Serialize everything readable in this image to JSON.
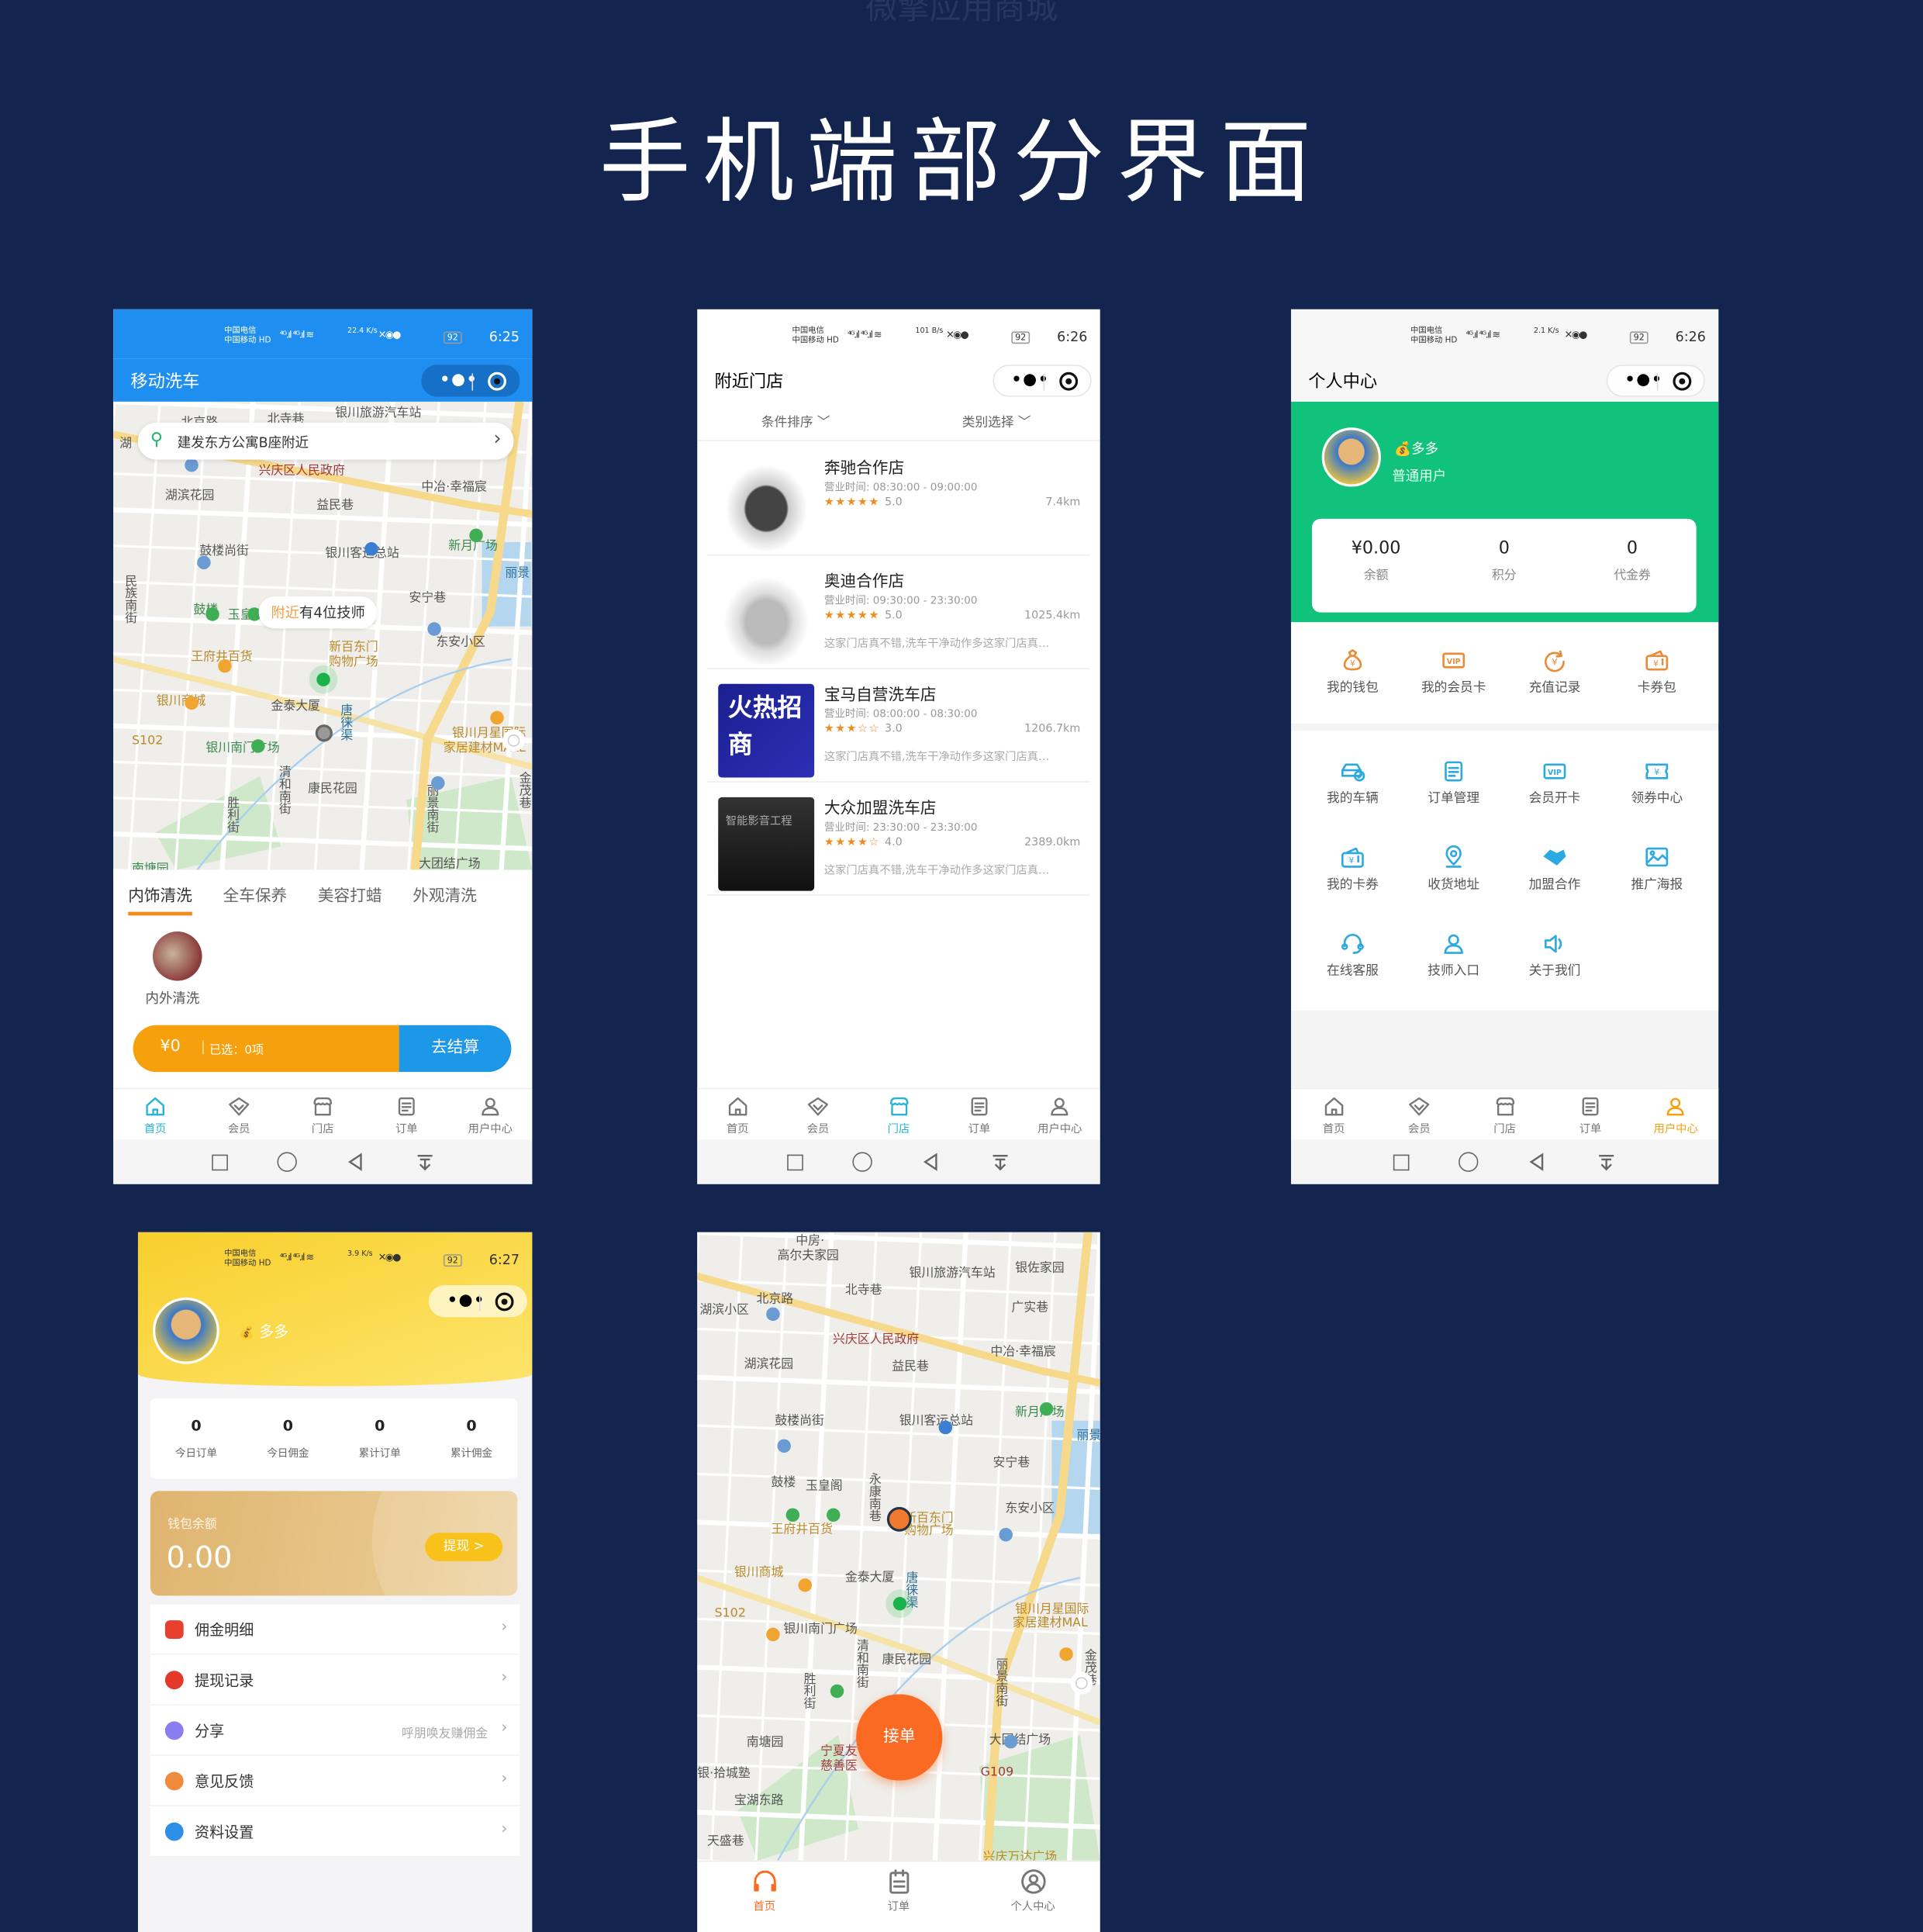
{
  "watermark": "微擎应用商城",
  "title": "手机端部分界面",
  "colors": {
    "background": "#13254f",
    "blue": "#1e8ff0",
    "green": "#10c27b",
    "orange": "#f5a00c",
    "teal": "#26b5d6",
    "fab": "#fb6a22",
    "yellow": "#fcd53a"
  },
  "status": {
    "carrier1": "中国电信",
    "carrier2": "中国移动 HD",
    "signal": "⁴ᴳ.ıl ⁴ᴳ.ıl ≋",
    "battery": "92"
  },
  "phone1": {
    "speed": "22.4 K/s",
    "time": "6:25",
    "title": "移动洗车",
    "location": "建发东方公寓B座附近",
    "nearby_prefix": "附近",
    "nearby_rest": "有4位技师",
    "tabs": [
      {
        "label": "内饰清洗",
        "active": true
      },
      {
        "label": "全车保养"
      },
      {
        "label": "美容打蜡"
      },
      {
        "label": "外观清洗"
      }
    ],
    "service": "内外清洗",
    "cart": {
      "price": "¥0",
      "selected": "已选：0项",
      "checkout": "去结算"
    },
    "map_labels": [
      "银川旅游汽车站",
      "北京路",
      "北寺巷",
      "湖",
      "兴庆区人民政府",
      "湖滨花园",
      "益民巷",
      "中冶·幸福宸",
      "鼓楼尚街",
      "银川客运总站",
      "新月广场",
      "安宁巷",
      "鼓楼",
      "玉皇",
      "东安小区",
      "王府井百货",
      "新百东门",
      "购物广场",
      "银川商城",
      "金泰大厦",
      "唐徕渠",
      "S102",
      "银川南门广场",
      "银川月星国际",
      "家居建材MALL",
      "康民花园",
      "清和南街",
      "胜利街",
      "丽景南街",
      "金茂巷",
      "大团结广场",
      "南塘园",
      "民族南街",
      "丽景"
    ]
  },
  "phone2": {
    "speed": "101 B/s",
    "time": "6:26",
    "title": "附近门店",
    "filters": [
      "条件排序",
      "类别选择"
    ],
    "stores": [
      {
        "name": "奔驰合作店",
        "hours": "营业时间:  08:30:00 - 09:00:00",
        "rating": "5.0",
        "distance": "7.4km",
        "review": ""
      },
      {
        "name": "奥迪合作店",
        "hours": "营业时间:  09:30:00 - 23:30:00",
        "rating": "5.0",
        "distance": "1025.4km",
        "review": "这家门店真不错,洗车干净动作多这家门店真…"
      },
      {
        "name": "宝马自营洗车店",
        "hours": "营业时间:  08:00:00 - 08:30:00",
        "rating": "3.0",
        "distance": "1206.7km",
        "review": "这家门店真不错,洗车干净动作多这家门店真…",
        "image_text": "火热招商"
      },
      {
        "name": "大众加盟洗车店",
        "hours": "营业时间:  23:30:00 - 23:30:00",
        "rating": "4.0",
        "distance": "2389.0km",
        "review": "这家门店真不错,洗车干净动作多这家门店真…",
        "image_text": "智能影音工程"
      }
    ]
  },
  "phone3": {
    "speed": "2.1 K/s",
    "time": "6:26",
    "title": "个人中心",
    "user": {
      "name": "多多",
      "level": "普通用户"
    },
    "stats": [
      {
        "value": "¥0.00",
        "label": "余额"
      },
      {
        "value": "0",
        "label": "积分"
      },
      {
        "value": "0",
        "label": "代金券"
      }
    ],
    "grid1": [
      {
        "label": "我的钱包",
        "icon": "money-bag"
      },
      {
        "label": "我的会员卡",
        "icon": "vip-card"
      },
      {
        "label": "充值记录",
        "icon": "recharge"
      },
      {
        "label": "卡券包",
        "icon": "coupon-wallet"
      }
    ],
    "grid2": [
      {
        "label": "我的车辆",
        "icon": "car"
      },
      {
        "label": "订单管理",
        "icon": "order"
      },
      {
        "label": "会员开卡",
        "icon": "vip-card"
      },
      {
        "label": "领券中心",
        "icon": "ticket"
      },
      {
        "label": "我的卡券",
        "icon": "coupon-wallet"
      },
      {
        "label": "收货地址",
        "icon": "location"
      },
      {
        "label": "加盟合作",
        "icon": "handshake"
      },
      {
        "label": "推广海报",
        "icon": "poster"
      },
      {
        "label": "在线客服",
        "icon": "headset"
      },
      {
        "label": "技师入口",
        "icon": "user"
      },
      {
        "label": "关于我们",
        "icon": "speaker"
      }
    ]
  },
  "nav_main": [
    {
      "label": "首页",
      "icon": "home"
    },
    {
      "label": "会员",
      "icon": "diamond"
    },
    {
      "label": "门店",
      "icon": "store"
    },
    {
      "label": "订单",
      "icon": "order"
    },
    {
      "label": "用户中心",
      "icon": "user"
    }
  ],
  "phone4": {
    "speed": "3.9 K/s",
    "time": "6:27",
    "user": "多多",
    "stats": [
      {
        "value": "0",
        "label": "今日订单"
      },
      {
        "value": "0",
        "label": "今日佣金"
      },
      {
        "value": "0",
        "label": "累计订单"
      },
      {
        "value": "0",
        "label": "累计佣金"
      }
    ],
    "wallet": {
      "label": "钱包余额",
      "value": "0.00",
      "withdraw": "提现 >"
    },
    "menu": [
      {
        "label": "佣金明细",
        "color": "#e8402e",
        "hint": ""
      },
      {
        "label": "提现记录",
        "color": "#e3392b",
        "hint": ""
      },
      {
        "label": "分享",
        "color": "#8b7cf0",
        "hint": "呼朋唤友赚佣金"
      },
      {
        "label": "意见反馈",
        "color": "#f08a3c",
        "hint": ""
      },
      {
        "label": "资料设置",
        "color": "#2e8fe8",
        "hint": ""
      }
    ]
  },
  "phone5": {
    "accept": "接单",
    "nav": [
      {
        "label": "首页",
        "icon": "headphones",
        "active": true
      },
      {
        "label": "订单",
        "icon": "clipboard"
      },
      {
        "label": "个人中心",
        "icon": "user-circle"
      }
    ],
    "map_labels": [
      "中房·",
      "高尔夫家园",
      "银川旅游汽车站",
      "银佐家园",
      "北京路",
      "北寺巷",
      "湖滨小区",
      "广实巷",
      "兴庆区人民政府",
      "中冶·幸福宸",
      "湖滨花园",
      "益民巷",
      "新月广场",
      "鼓楼尚街",
      "银川客运总站",
      "安宁巷",
      "鼓楼",
      "玉皇阁",
      "永康南巷",
      "东安小区",
      "新百东门",
      "购物广场",
      "王府井百货",
      "银川商城",
      "金泰大厦",
      "唐徕渠",
      "S102",
      "银川南门广场",
      "银川月星国际",
      "家居建材MAL",
      "康民花园",
      "清和南街",
      "胜利街",
      "丽景南街",
      "金茂巷",
      "南塘园",
      "宁夏友",
      "慈善医",
      "大团结广场",
      "银·拾城塾",
      "G109",
      "宝湖东路",
      "天盛巷",
      "兴庆万达广场",
      "丽景湖"
    ]
  }
}
